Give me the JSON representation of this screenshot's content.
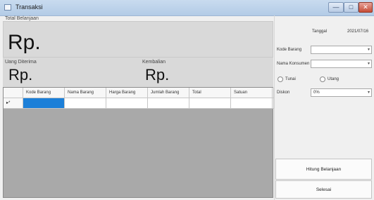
{
  "window": {
    "title": "Transaksi",
    "min_glyph": "—",
    "max_glyph": "□",
    "close_glyph": "✕"
  },
  "summary": {
    "total_label": "Total Belanjaan",
    "total_value": "Rp.",
    "paid_label": "Uang Diterima",
    "paid_value": "Rp.",
    "change_label": "Kembalian",
    "change_value": "Rp."
  },
  "grid": {
    "columns": [
      "Kode Barang",
      "Nama Barang",
      "Harga Barang",
      "Jumlah Barang",
      "Total",
      "Satuan"
    ],
    "new_row_marker": "▸*"
  },
  "form": {
    "date_label": "Tanggal",
    "date_value": "2021/07/16",
    "item_code_label": "Kode Barang",
    "customer_label": "Nama Konsumen",
    "payment_options": [
      "Tunai",
      "Utang"
    ],
    "discount_label": "Diskon",
    "discount_value": "0%",
    "dropdown_glyph": "▾"
  },
  "actions": {
    "calculate_label": "Hitung Belanjaan",
    "clear_label": "Selesai"
  }
}
